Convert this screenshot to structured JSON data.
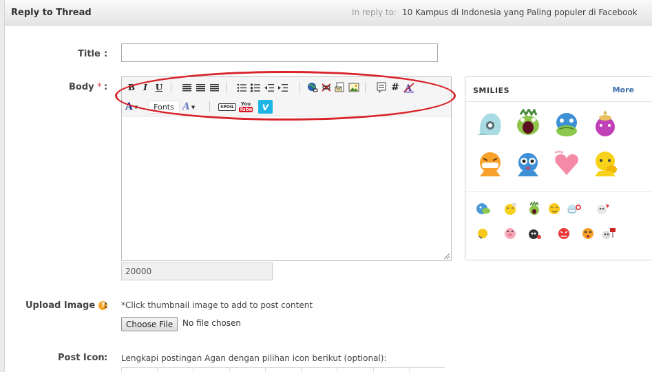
{
  "header": {
    "title": "Reply to Thread",
    "in_reply_to_label": "In reply to:",
    "thread_title": "10 Kampus di Indonesia yang Paling populer di Facebook"
  },
  "form": {
    "title_label": "Title",
    "colon": ":",
    "title_value": "",
    "body_label": "Body",
    "body_required": "*",
    "body_value": "",
    "char_counter": "20000",
    "upload_label": "Upload Image",
    "upload_help": "?",
    "upload_hint": "*Click thumbnail image to add to post content",
    "choose_file_label": "Choose File",
    "file_status": "No file chosen",
    "post_icon_label": "Post Icon",
    "post_icon_hint": "Lengkapi postingan Agan dengan pilihan icon berikut (optional):"
  },
  "toolbar": {
    "bold": "B",
    "italic": "I",
    "underline": "U",
    "hash": "#",
    "font_color": "A",
    "fonts_label": "Fonts",
    "font_size": "A",
    "spoiler": "SPOIL",
    "youtube_top": "You",
    "youtube_bottom": "Tube",
    "vimeo": "v"
  },
  "smilies": {
    "title": "SMILIES",
    "more_label": "More"
  },
  "colors": {
    "highlight": "#d8232a",
    "link": "#3a6ea8",
    "help": "#f3a326"
  }
}
